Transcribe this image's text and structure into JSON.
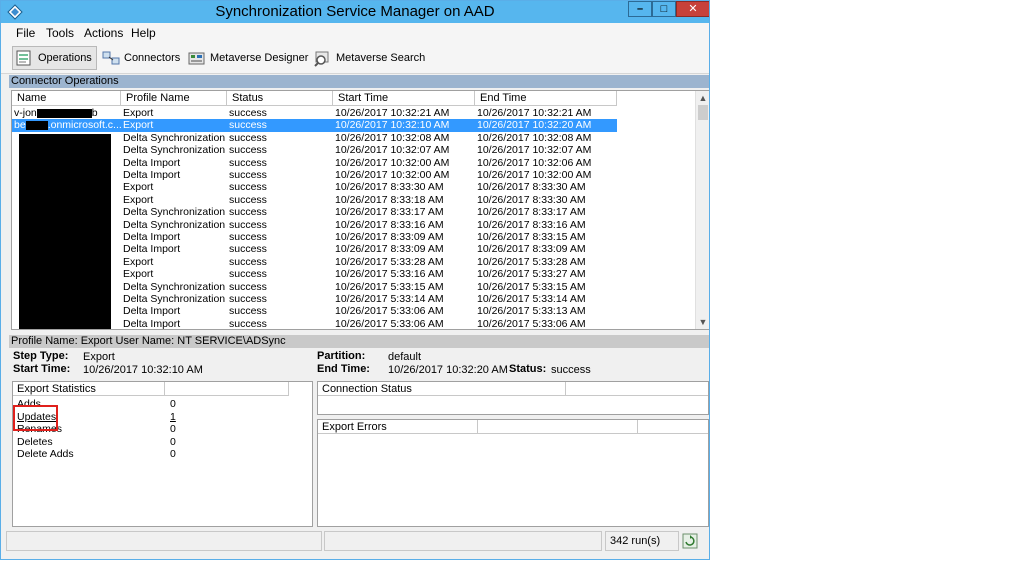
{
  "window": {
    "title": "Synchronization Service Manager on AAD",
    "minimize": "–",
    "maximize": "□",
    "close": "✕"
  },
  "menu": [
    "File",
    "Tools",
    "Actions",
    "Help"
  ],
  "toolbar": [
    {
      "label": "Operations",
      "icon": "operations-icon",
      "active": true
    },
    {
      "label": "Connectors",
      "icon": "connectors-icon",
      "active": false
    },
    {
      "label": "Metaverse Designer",
      "icon": "metaverse-designer-icon",
      "active": false
    },
    {
      "label": "Metaverse Search",
      "icon": "metaverse-search-icon",
      "active": false
    }
  ],
  "connector_operations": {
    "header": "Connector Operations",
    "columns": [
      "Name",
      "Profile Name",
      "Status",
      "Start Time",
      "End Time"
    ],
    "rows": [
      {
        "name": "v-jon",
        "name_tail": "b",
        "profile": "Export",
        "status": "success",
        "start": "10/26/2017 10:32:21 AM",
        "end": "10/26/2017 10:32:21 AM"
      },
      {
        "name": "be",
        "name_tail": ".onmicrosoft.c...",
        "profile": "Export",
        "status": "success",
        "start": "10/26/2017 10:32:10 AM",
        "end": "10/26/2017 10:32:20 AM"
      },
      {
        "name": "",
        "profile": "Delta Synchronization",
        "status": "success",
        "start": "10/26/2017 10:32:08 AM",
        "end": "10/26/2017 10:32:08 AM"
      },
      {
        "name": "",
        "profile": "Delta Synchronization",
        "status": "success",
        "start": "10/26/2017 10:32:07 AM",
        "end": "10/26/2017 10:32:07 AM"
      },
      {
        "name": "",
        "profile": "Delta Import",
        "status": "success",
        "start": "10/26/2017 10:32:00 AM",
        "end": "10/26/2017 10:32:06 AM"
      },
      {
        "name": "",
        "profile": "Delta Import",
        "status": "success",
        "start": "10/26/2017 10:32:00 AM",
        "end": "10/26/2017 10:32:00 AM"
      },
      {
        "name": "",
        "profile": "Export",
        "status": "success",
        "start": "10/26/2017 8:33:30 AM",
        "end": "10/26/2017 8:33:30 AM"
      },
      {
        "name": "",
        "profile": "Export",
        "status": "success",
        "start": "10/26/2017 8:33:18 AM",
        "end": "10/26/2017 8:33:30 AM"
      },
      {
        "name": "",
        "profile": "Delta Synchronization",
        "status": "success",
        "start": "10/26/2017 8:33:17 AM",
        "end": "10/26/2017 8:33:17 AM"
      },
      {
        "name": "",
        "profile": "Delta Synchronization",
        "status": "success",
        "start": "10/26/2017 8:33:16 AM",
        "end": "10/26/2017 8:33:16 AM"
      },
      {
        "name": "",
        "profile": "Delta Import",
        "status": "success",
        "start": "10/26/2017 8:33:09 AM",
        "end": "10/26/2017 8:33:15 AM"
      },
      {
        "name": "",
        "profile": "Delta Import",
        "status": "success",
        "start": "10/26/2017 8:33:09 AM",
        "end": "10/26/2017 8:33:09 AM"
      },
      {
        "name": "",
        "profile": "Export",
        "status": "success",
        "start": "10/26/2017 5:33:28 AM",
        "end": "10/26/2017 5:33:28 AM"
      },
      {
        "name": "",
        "profile": "Export",
        "status": "success",
        "start": "10/26/2017 5:33:16 AM",
        "end": "10/26/2017 5:33:27 AM"
      },
      {
        "name": "",
        "profile": "Delta Synchronization",
        "status": "success",
        "start": "10/26/2017 5:33:15 AM",
        "end": "10/26/2017 5:33:15 AM"
      },
      {
        "name": "",
        "profile": "Delta Synchronization",
        "status": "success",
        "start": "10/26/2017 5:33:14 AM",
        "end": "10/26/2017 5:33:14 AM"
      },
      {
        "name": "",
        "profile": "Delta Import",
        "status": "success",
        "start": "10/26/2017 5:33:06 AM",
        "end": "10/26/2017 5:33:13 AM"
      },
      {
        "name": "",
        "profile": "Delta Import",
        "status": "success",
        "start": "10/26/2017 5:33:06 AM",
        "end": "10/26/2017 5:33:06 AM"
      }
    ],
    "selected_index": 1
  },
  "details": {
    "header": "Profile Name: Export  User Name: NT SERVICE\\ADSync",
    "step_type_label": "Step Type:",
    "step_type": "Export",
    "start_time_label": "Start Time:",
    "start_time": "10/26/2017 10:32:10 AM",
    "partition_label": "Partition:",
    "partition": "default",
    "end_time_label": "End Time:",
    "end_time": "10/26/2017 10:32:20 AM",
    "status_label": "Status:",
    "status": "success"
  },
  "export_statistics": {
    "header": "Export Statistics",
    "rows": [
      {
        "label": "Adds",
        "value": "0"
      },
      {
        "label": "Updates",
        "value": "1"
      },
      {
        "label": "Renames",
        "value": "0"
      },
      {
        "label": "Deletes",
        "value": "0"
      },
      {
        "label": "Delete Adds",
        "value": "0"
      }
    ]
  },
  "connection_status": {
    "header": "Connection Status"
  },
  "export_errors": {
    "header": "Export Errors"
  },
  "statusbar": {
    "runs": "342 run(s)"
  },
  "colors": {
    "title_bar": "#56b6ee",
    "section_header": "#9cb4cf",
    "selection": "#3399ff",
    "highlight_box": "#e0201c"
  }
}
